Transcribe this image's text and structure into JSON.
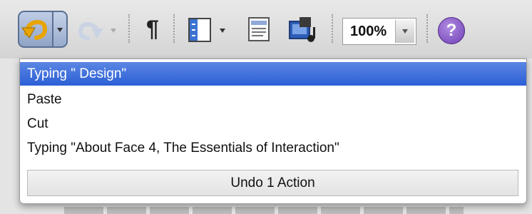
{
  "toolbar": {
    "zoom_value": "100%",
    "help_glyph": "?",
    "paragraph_glyph": "¶",
    "icons": [
      "undo-icon",
      "redo-icon",
      "paragraph-icon",
      "sidebar-layout-icon",
      "gallery-icon",
      "media-browser-icon",
      "help-icon"
    ]
  },
  "undo_menu": {
    "items": [
      "Typing \" Design\"",
      "Paste",
      "Cut",
      "Typing \"About Face 4, The Essentials of Interaction\""
    ],
    "selected_index": 0,
    "undo_action_label": "Undo 1 Action"
  },
  "colors": {
    "selection": "#2b5fd5",
    "toolbar_bg": "#d4d4d4",
    "help_purple": "#6f3fb6"
  }
}
